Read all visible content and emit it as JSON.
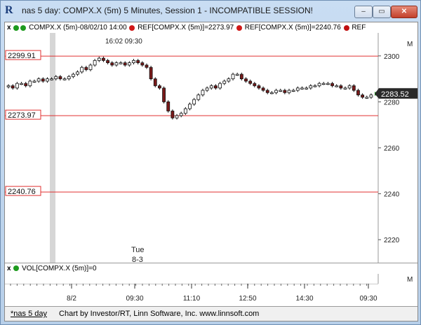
{
  "window": {
    "title": "nas 5 day: COMPX.X (5m) 5 Minutes, Session 1 - INCOMPATIBLE SESSION!",
    "app_icon": "R",
    "min_label": "–",
    "max_label": "▭",
    "close_label": "✕"
  },
  "legend": {
    "close_marker": "x",
    "series_label": "COMPX.X (5m)-08/02/10 14:00",
    "ref1_label": "REF[COMPX.X (5m)]=2273.97",
    "ref2_label": "REF[COMPX.X (5m)]=2240.76",
    "ref3_label": "REF"
  },
  "time_labels": {
    "top_times": "16:02  09:30",
    "day_label_1": "Tue",
    "day_label_2": "8-3"
  },
  "price_panel_marker": "M",
  "volume_panel_marker": "M",
  "volume_legend": "VOL[COMPX.X (5m)]=0",
  "status": {
    "tab": "*nas 5 day",
    "credit": "Chart by Investor/RT, Linn Software, Inc. www.linnsoft.com"
  },
  "colors": {
    "ref_line": "#e03030",
    "up_bar": "#ffffff",
    "down_bar": "#7a1a1a",
    "last_price_bg": "#2a2a2a",
    "last_price_marker": "#1d9a1d",
    "session_shade": "#d6d6d6"
  },
  "chart_data": {
    "type": "candlestick",
    "symbol": "COMPX.X",
    "interval": "5m",
    "ylim": [
      2210,
      2310
    ],
    "yticks": [
      2220,
      2240,
      2260,
      2280,
      2300
    ],
    "x_tick_labels": [
      "8/2",
      "09:30",
      "11:10",
      "12:50",
      "14:30",
      "09:30"
    ],
    "ref_levels": [
      {
        "label": "2299.91",
        "value": 2299.91
      },
      {
        "label": "2273.97",
        "value": 2273.97
      },
      {
        "label": "2240.76",
        "value": 2240.76
      }
    ],
    "last_price": {
      "label": "2283.52",
      "value": 2283.52
    },
    "closes": [
      2287,
      2286,
      2288,
      2288,
      2287,
      2289,
      2289,
      2290,
      2289,
      2290,
      2290,
      2291,
      2290,
      2290,
      2291,
      2292,
      2293,
      2295,
      2294,
      2296,
      2298,
      2299,
      2298,
      2297,
      2296,
      2297,
      2297,
      2296,
      2297,
      2298,
      2297,
      2296,
      2295,
      2290,
      2287,
      2286,
      2280,
      2276,
      2273,
      2274,
      2275,
      2277,
      2279,
      2281,
      2283,
      2285,
      2286,
      2287,
      2286,
      2288,
      2289,
      2290,
      2292,
      2292,
      2290,
      2289,
      2288,
      2287,
      2286,
      2285,
      2284,
      2284,
      2285,
      2285,
      2284,
      2285,
      2285,
      2286,
      2286,
      2286,
      2287,
      2287,
      2288,
      2288,
      2288,
      2287,
      2287,
      2286,
      2286,
      2287,
      2285,
      2283,
      2282,
      2282,
      2283
    ]
  }
}
